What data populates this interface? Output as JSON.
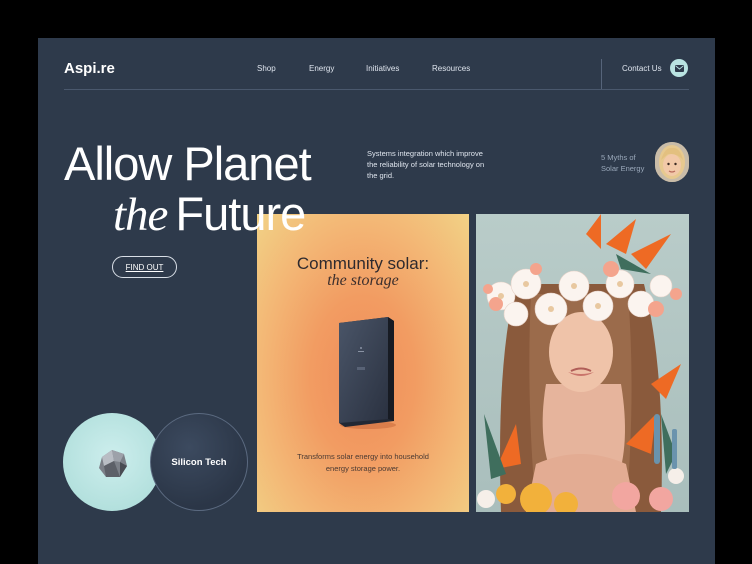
{
  "brand": {
    "logo": "Aspi.re"
  },
  "nav": {
    "items": [
      {
        "label": "Shop"
      },
      {
        "label": "Energy"
      },
      {
        "label": "Initiatives"
      },
      {
        "label": "Resources"
      }
    ],
    "contact": "Contact Us"
  },
  "hero": {
    "line1": "Allow Planet",
    "line2_italic": "the",
    "line2": "Future",
    "cta": "FIND OUT",
    "intro": "Systems integration which improve the reliability of solar technology on the grid."
  },
  "aside": {
    "myths": "5 Myths of Solar Energy"
  },
  "card": {
    "title": "Community solar:",
    "subtitle": "the storage",
    "description": "Transforms solar energy into household energy storage power."
  },
  "feature": {
    "label": "Silicon Tech"
  },
  "colors": {
    "page_bg": "#2e3a4b",
    "accent_mint": "#b9e3e1",
    "card_orange": "#f29c62"
  },
  "icons": {
    "mail": "mail-icon"
  }
}
